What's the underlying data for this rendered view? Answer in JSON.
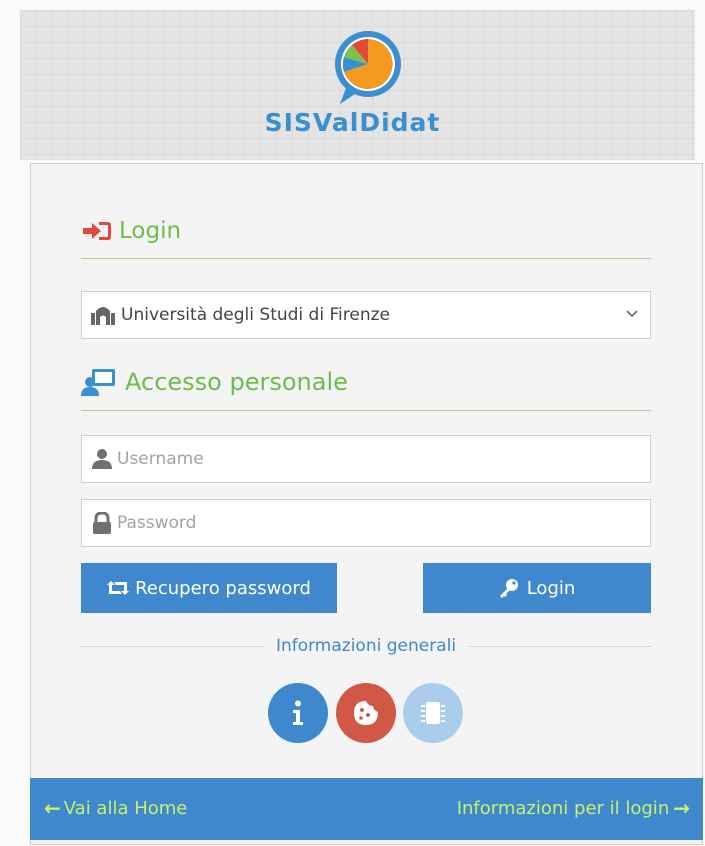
{
  "brand": {
    "name": "SISValDidat"
  },
  "login_section": {
    "title": "Login"
  },
  "university_select": {
    "selected": "Università degli Studi di Firenze"
  },
  "access_section": {
    "title": "Accesso personale"
  },
  "username": {
    "placeholder": "Username",
    "value": ""
  },
  "password": {
    "placeholder": "Password",
    "value": ""
  },
  "buttons": {
    "recover": "Recupero password",
    "login": "Login"
  },
  "info": {
    "label": "Informazioni generali"
  },
  "footer": {
    "home": "Vai alla Home",
    "login_info": "Informazioni per il login"
  },
  "colors": {
    "primary_blue": "#3f88cd",
    "green_accent": "#6dbd4a",
    "red_accent": "#e04a3a",
    "cookie_red": "#d25846",
    "chip_light_blue": "#a9cdeb",
    "footer_link": "#c9f06a"
  },
  "icons": {
    "login_head": "sign-in-icon",
    "university": "university-icon",
    "access_head": "user-screen-icon",
    "username": "user-icon",
    "password": "lock-icon",
    "recover": "retweet-icon",
    "login_button": "key-icon",
    "info": "info-icon",
    "cookie": "cookie-icon",
    "chip": "chip-icon",
    "home_arrow": "arrow-left-icon",
    "login_info_arrow": "arrow-right-icon"
  }
}
